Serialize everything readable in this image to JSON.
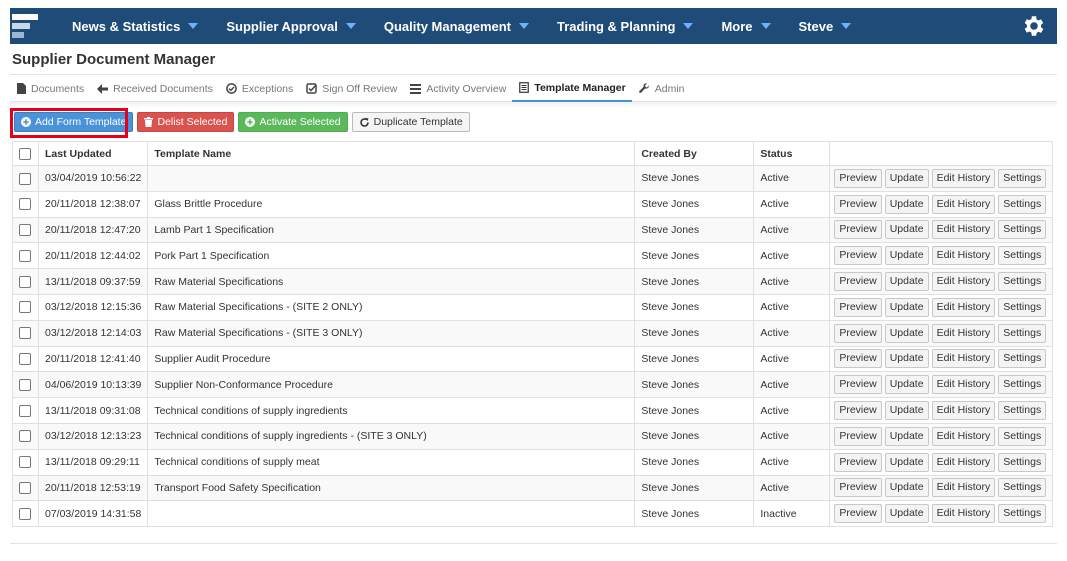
{
  "nav": {
    "items": [
      {
        "label": "News & Statistics"
      },
      {
        "label": "Supplier Approval"
      },
      {
        "label": "Quality Management"
      },
      {
        "label": "Trading & Planning"
      },
      {
        "label": "More"
      },
      {
        "label": "Steve"
      }
    ],
    "settings_icon": "gear-icon"
  },
  "page": {
    "title": "Supplier Document Manager"
  },
  "tabs": [
    {
      "label": "Documents",
      "icon": "document-icon"
    },
    {
      "label": "Received Documents",
      "icon": "arrow-left-icon"
    },
    {
      "label": "Exceptions",
      "icon": "check-circle-icon"
    },
    {
      "label": "Sign Off Review",
      "icon": "check-square-icon"
    },
    {
      "label": "Activity Overview",
      "icon": "list-icon"
    },
    {
      "label": "Template Manager",
      "icon": "file-list-icon",
      "active": true
    },
    {
      "label": "Admin",
      "icon": "wrench-icon"
    }
  ],
  "toolbar": {
    "add_label": "Add Form Template",
    "delist_label": "Delist Selected",
    "activate_label": "Activate Selected",
    "duplicate_label": "Duplicate Template"
  },
  "table": {
    "headers": {
      "last_updated": "Last Updated",
      "template_name": "Template Name",
      "created_by": "Created By",
      "status": "Status"
    },
    "action_labels": {
      "preview": "Preview",
      "update": "Update",
      "edit_history": "Edit History",
      "settings": "Settings"
    },
    "rows": [
      {
        "updated": "03/04/2019 10:56:22",
        "name": "",
        "by": "Steve Jones",
        "status": "Active"
      },
      {
        "updated": "20/11/2018 12:38:07",
        "name": "Glass Brittle Procedure",
        "by": "Steve Jones",
        "status": "Active"
      },
      {
        "updated": "20/11/2018 12:47:20",
        "name": "Lamb Part 1 Specification",
        "by": "Steve Jones",
        "status": "Active"
      },
      {
        "updated": "20/11/2018 12:44:02",
        "name": "Pork Part 1 Specification",
        "by": "Steve Jones",
        "status": "Active"
      },
      {
        "updated": "13/11/2018 09:37:59",
        "name": "Raw Material Specifications",
        "by": "Steve Jones",
        "status": "Active"
      },
      {
        "updated": "03/12/2018 12:15:36",
        "name": "Raw Material Specifications - (SITE 2 ONLY)",
        "by": "Steve Jones",
        "status": "Active"
      },
      {
        "updated": "03/12/2018 12:14:03",
        "name": "Raw Material Specifications - (SITE 3 ONLY)",
        "by": "Steve Jones",
        "status": "Active"
      },
      {
        "updated": "20/11/2018 12:41:40",
        "name": "Supplier Audit Procedure",
        "by": "Steve Jones",
        "status": "Active"
      },
      {
        "updated": "04/06/2019 10:13:39",
        "name": "Supplier Non-Conformance Procedure",
        "by": "Steve Jones",
        "status": "Active"
      },
      {
        "updated": "13/11/2018 09:31:08",
        "name": "Technical conditions of supply ingredients",
        "by": "Steve Jones",
        "status": "Active"
      },
      {
        "updated": "03/12/2018 12:13:23",
        "name": "Technical conditions of supply ingredients - (SITE 3 ONLY)",
        "by": "Steve Jones",
        "status": "Active"
      },
      {
        "updated": "13/11/2018 09:29:11",
        "name": "Technical conditions of supply meat",
        "by": "Steve Jones",
        "status": "Active"
      },
      {
        "updated": "20/11/2018 12:53:19",
        "name": "Transport Food Safety Specification",
        "by": "Steve Jones",
        "status": "Active"
      },
      {
        "updated": "07/03/2019 14:31:58",
        "name": "",
        "by": "Steve Jones",
        "status": "Inactive"
      }
    ]
  },
  "colors": {
    "nav_bg": "#1f4b78",
    "primary": "#4a93d9",
    "danger": "#d9534f",
    "success": "#5cb85c",
    "highlight": "#e3001b"
  }
}
